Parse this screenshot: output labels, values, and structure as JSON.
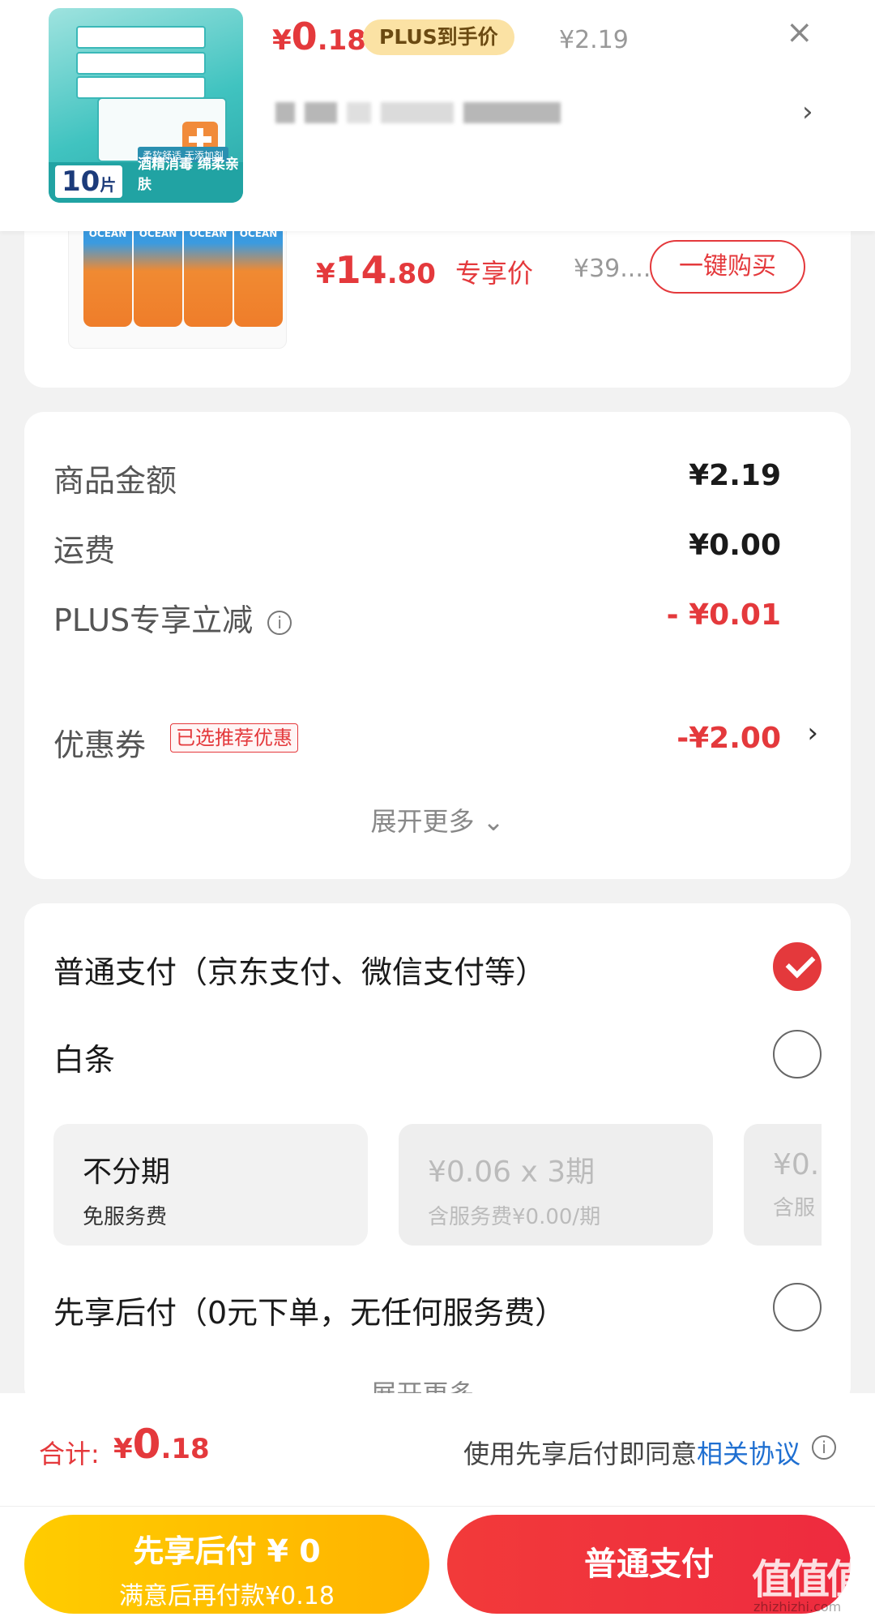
{
  "popup": {
    "thumb_tag": "柔软舒适 无添加剂",
    "thumb_count": "10",
    "thumb_count_unit": "片",
    "thumb_band": "酒精消毒 绵柔亲肤",
    "price_symbol": "¥",
    "price_int": "0",
    "price_dec": ".18",
    "plus_badge": "PLUS到手价",
    "original_price": "¥2.19",
    "close_icon": "×",
    "chevron": "›"
  },
  "recommend": {
    "price_symbol": "¥",
    "price_int": "14",
    "price_dec": ".80",
    "price_tag": "专享价",
    "original_price": "¥39....",
    "buy_button": "一键购买"
  },
  "amounts": {
    "rows": [
      {
        "label": "商品金额",
        "value": "¥2.19"
      },
      {
        "label": "运费",
        "value": "¥0.00"
      },
      {
        "label": "PLUS专享立减",
        "value": "- ¥0.01"
      },
      {
        "label": "优惠券",
        "value": "-¥2.00"
      }
    ],
    "coupon_badge": "已选推荐优惠",
    "expand": "展开更多 ⌄"
  },
  "payment": {
    "options": [
      {
        "label": "普通支付（京东支付、微信支付等）",
        "checked": true
      },
      {
        "label": "白条",
        "checked": false
      },
      {
        "label": "先享后付（0元下单，无任何服务费）",
        "checked": false
      }
    ],
    "plans": [
      {
        "title": "不分期",
        "sub": "免服务费"
      },
      {
        "title": "¥0.06 x 3期",
        "sub": "含服务费¥0.00/期"
      },
      {
        "title": "¥0.",
        "sub": "含服"
      }
    ],
    "expand": "展开更多 ⌄"
  },
  "total": {
    "label": "合计:",
    "price_symbol": "¥",
    "price_int": "0",
    "price_dec": ".18",
    "agree_text": "使用先享后付即同意",
    "agree_link": "相关协议"
  },
  "buttons": {
    "left_line1": "先享后付 ¥ 0",
    "left_line2": "满意后再付款¥0.18",
    "right": "普通支付"
  },
  "watermark": {
    "logo": "值值值",
    "site": "zhizhizhi.com"
  },
  "colors": {
    "accent": "#e4393c",
    "gold": "#ffb300",
    "link": "#1f6fd1"
  }
}
